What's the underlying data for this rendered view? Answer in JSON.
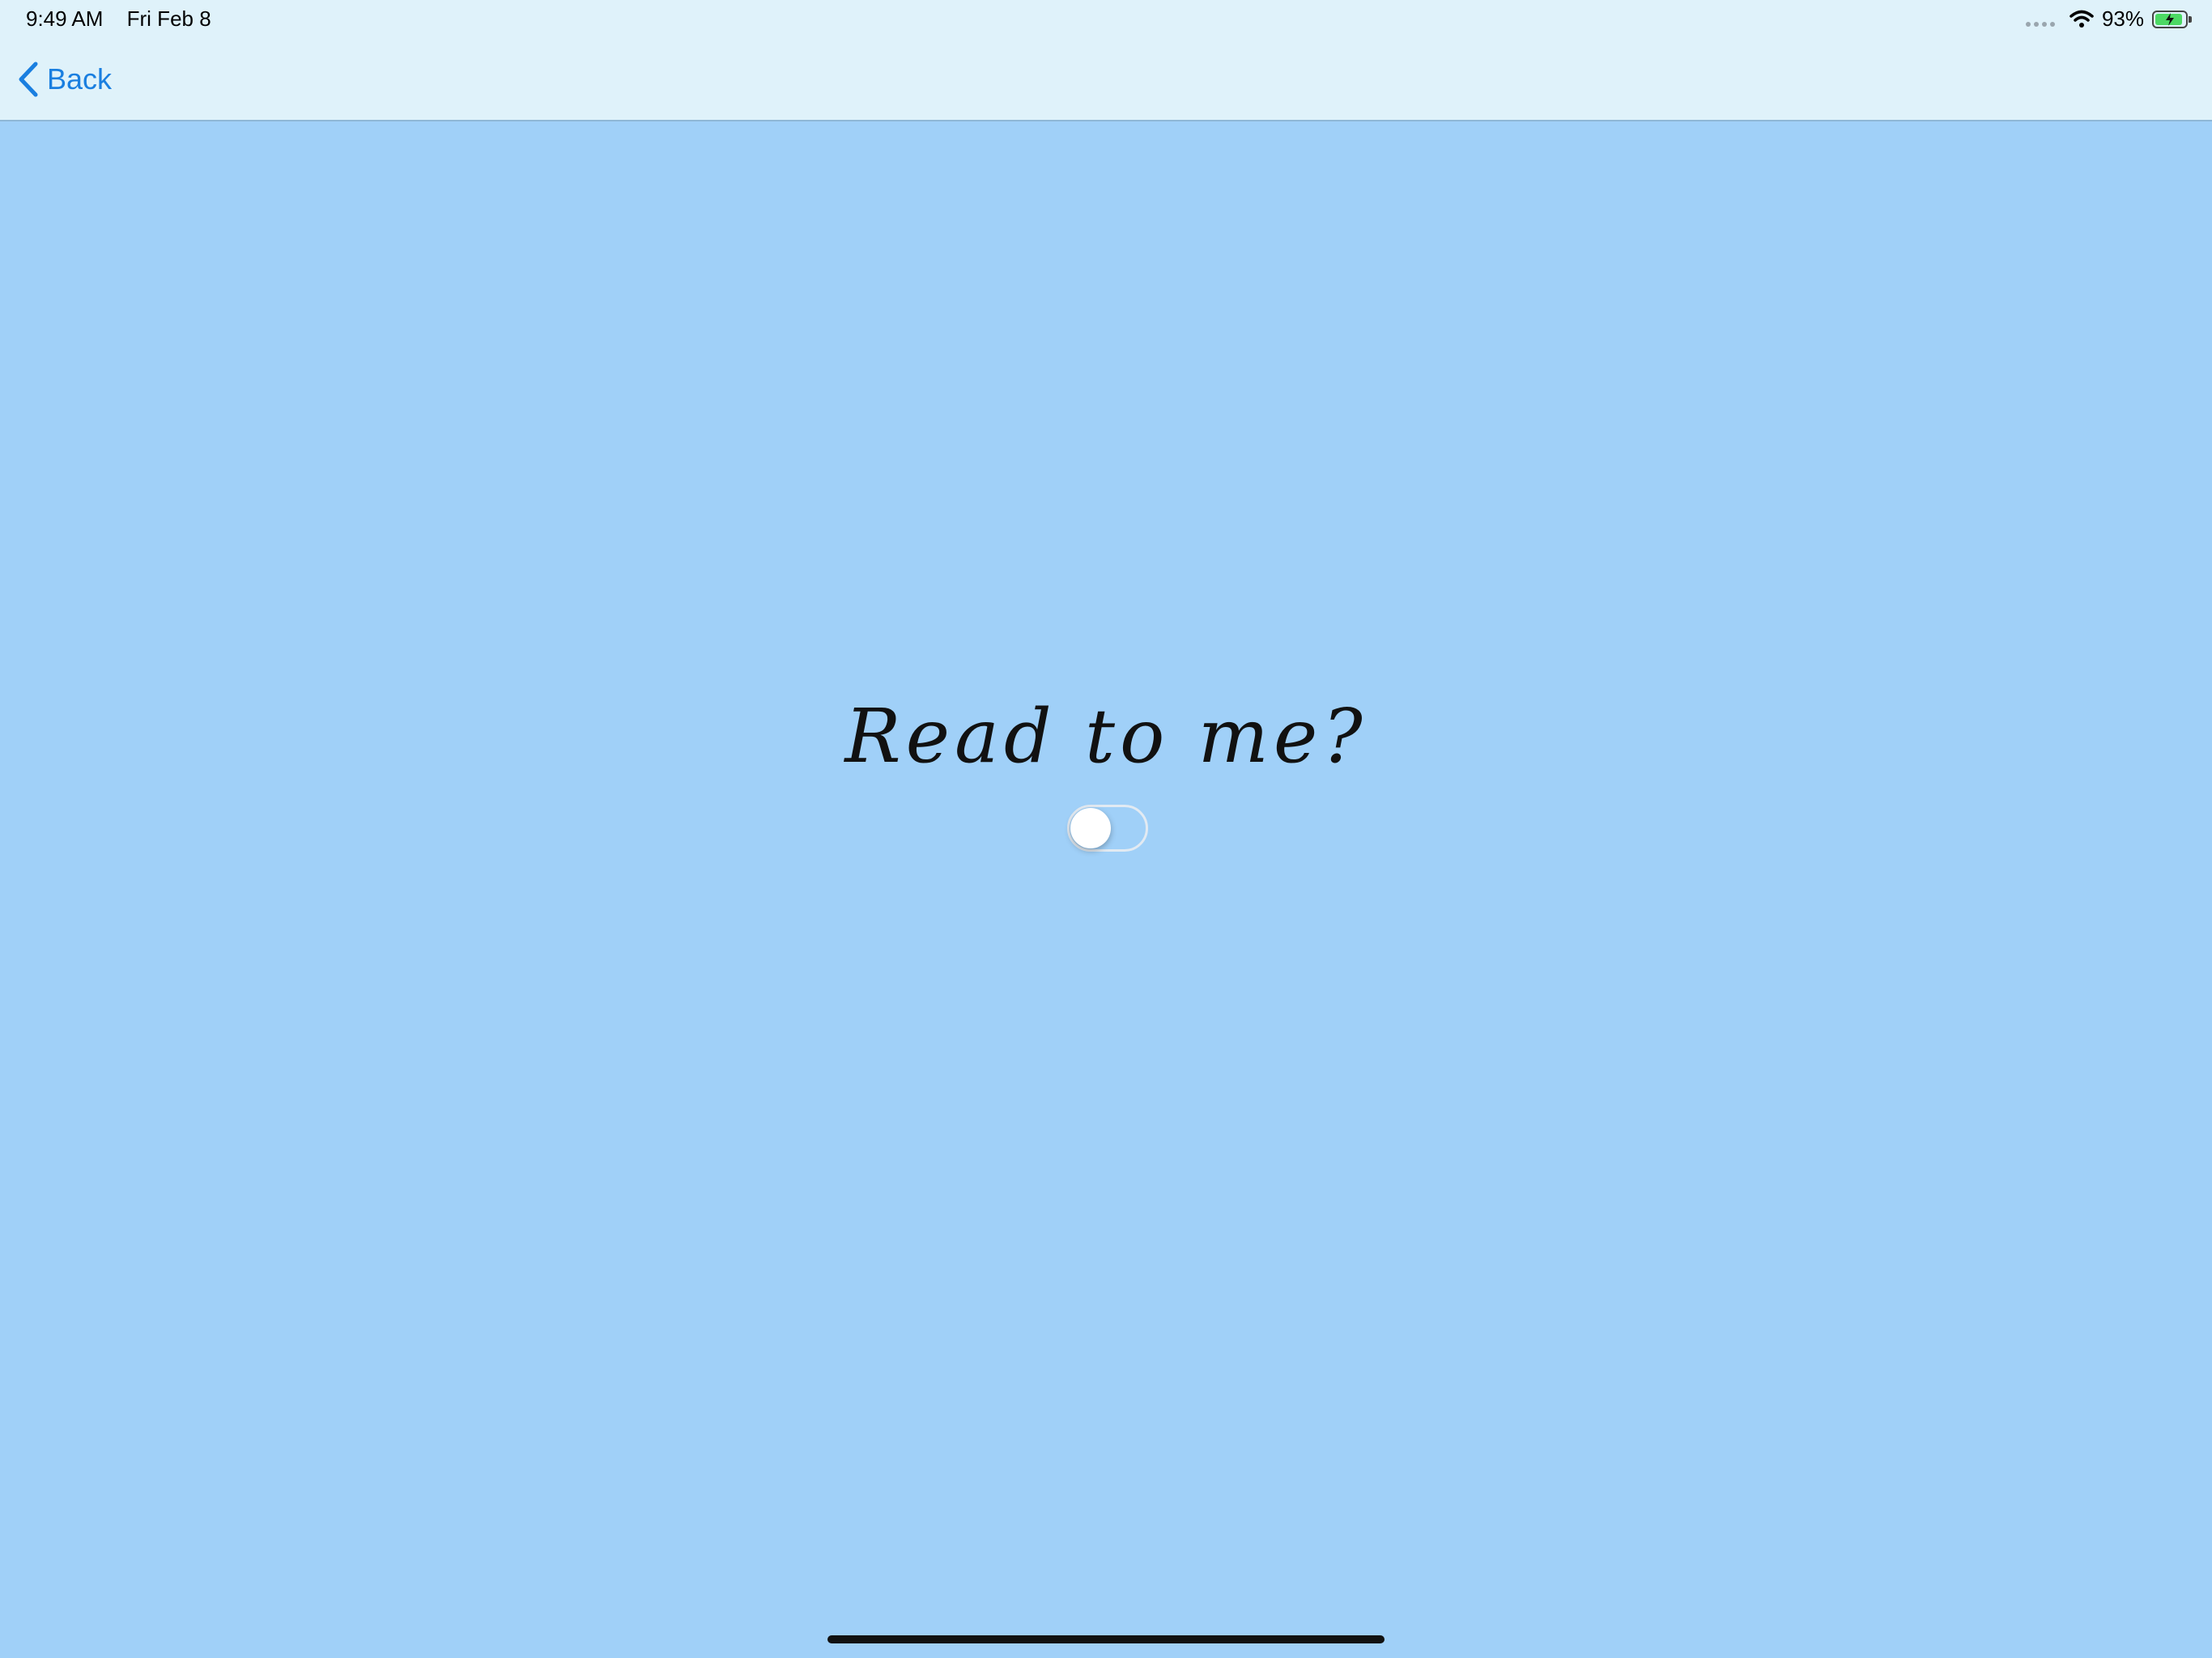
{
  "status_bar": {
    "time": "9:49 AM",
    "date": "Fri Feb 8",
    "battery_percent": "93%",
    "battery_level": 0.93,
    "wifi_icon": "wifi-icon",
    "battery_icon": "battery-charging-icon"
  },
  "nav": {
    "back_label": "Back",
    "back_icon": "chevron-left-icon"
  },
  "main": {
    "prompt": "Read to me?",
    "toggle_on": false
  },
  "colors": {
    "background": "#a0d0f8",
    "nav_background": "#dff2fa",
    "accent": "#1a7fe0",
    "battery_fill": "#4cd964"
  }
}
